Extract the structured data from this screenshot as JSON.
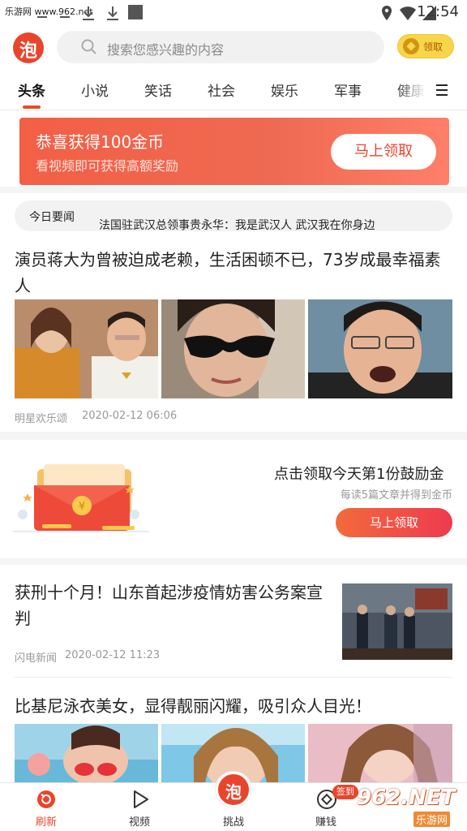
{
  "status_bar": {
    "site_label": "乐游网 www.962.net",
    "time": "12:54"
  },
  "header": {
    "logo_glyph": "泡",
    "search_placeholder": "搜索您感兴趣的内容",
    "coin_button_label": "领取"
  },
  "tabs": [
    {
      "label": "头条",
      "active": true
    },
    {
      "label": "小说"
    },
    {
      "label": "笑话"
    },
    {
      "label": "社会"
    },
    {
      "label": "娱乐"
    },
    {
      "label": "军事"
    },
    {
      "label": "健康"
    }
  ],
  "banner": {
    "title": "恭喜获得100金币",
    "subtitle": "看视频即可获得高额奖励",
    "button": "马上领取"
  },
  "hot_news": {
    "label": "今日要闻",
    "headline": "法国驻武汉总领事贵永华：我是武汉人 武汉我在你身边"
  },
  "article1": {
    "title": "演员蒋大为曾被迫成老赖，生活困顿不已，73岁成最幸福素人",
    "source": "明星欢乐颂",
    "date": "2020-02-12 06:06"
  },
  "reward_card": {
    "title": "点击领取今天第1份鼓励金",
    "subtitle": "每读5篇文章并得到金币",
    "button": "马上领取",
    "envelope_glyph": "¥"
  },
  "article2": {
    "title": "获刑十个月！山东首起涉疫情妨害公务案宣判",
    "source": "闪电新闻",
    "date": "2020-02-12 11:23"
  },
  "article3": {
    "title": "比基尼泳衣美女，显得靓丽闪耀，吸引众人目光！"
  },
  "bottom_nav": {
    "items": [
      {
        "label": "刷新",
        "icon": "refresh-icon",
        "active": true
      },
      {
        "label": "视频",
        "icon": "play-icon"
      },
      {
        "label": "挑战",
        "icon": "pao-logo-icon"
      },
      {
        "label": "赚钱",
        "icon": "coin-icon"
      }
    ],
    "badge": "签到",
    "center_glyph": "泡"
  },
  "watermark": {
    "big": "962.NET",
    "small": "乐游网"
  },
  "colors": {
    "accent": "#e8452c",
    "gold": "#f7d64a"
  }
}
